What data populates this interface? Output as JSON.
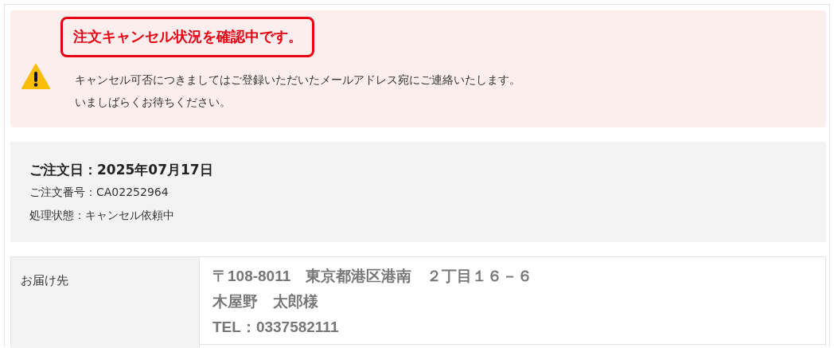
{
  "alert": {
    "title": "注文キャンセル状況を確認中です。",
    "lines": [
      "キャンセル可否につきましてはご登録いただいたメールアドレス宛にご連絡いたします。",
      "いましばらくお待ちください。"
    ]
  },
  "order": {
    "date": "ご注文日：2025年07月17日",
    "details": [
      "ご注文番号：CA02252964",
      "処理状態：キャンセル依頼中"
    ]
  },
  "table": {
    "rows": [
      {
        "label": "お届け先",
        "lines": [
          "〒108-8011　東京都港区港南　２丁目１６－６",
          "木屋野　太郎様",
          "TEL：0337582111"
        ]
      }
    ]
  }
}
